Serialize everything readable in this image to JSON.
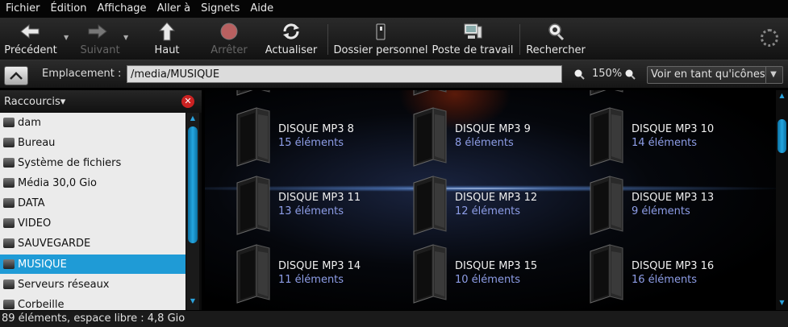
{
  "menu": [
    "Fichier",
    "Édition",
    "Affichage",
    "Aller à",
    "Signets",
    "Aide"
  ],
  "toolbar": {
    "back_label": "Précédent",
    "forward_label": "Suivant",
    "up_label": "Haut",
    "stop_label": "Arrêter",
    "reload_label": "Actualiser",
    "home_label": "Dossier personnel",
    "computer_label": "Poste de travail",
    "search_label": "Rechercher"
  },
  "location": {
    "label": "Emplacement :",
    "value": "/media/MUSIQUE",
    "zoom": "150%",
    "view_mode": "Voir en tant qu'icônes"
  },
  "sidebar": {
    "title": "Raccourcis",
    "items": [
      {
        "label": "dam",
        "icon": "home-icon"
      },
      {
        "label": "Bureau",
        "icon": "desktop-icon"
      },
      {
        "label": "Système de fichiers",
        "icon": "drive-icon"
      },
      {
        "label": "Média 30,0 Gio",
        "icon": "drive-icon"
      },
      {
        "label": "DATA",
        "icon": "drive-icon"
      },
      {
        "label": "VIDEO",
        "icon": "drive-icon"
      },
      {
        "label": "SAUVEGARDE",
        "icon": "drive-icon"
      },
      {
        "label": "MUSIQUE",
        "icon": "drive-icon"
      },
      {
        "label": "Serveurs réseaux",
        "icon": "network-icon"
      },
      {
        "label": "Corbeille",
        "icon": "trash-icon"
      }
    ],
    "selected_index": 7
  },
  "folders": [
    {
      "name": "DISQUE MP3 8",
      "count": "15 éléments"
    },
    {
      "name": "DISQUE MP3 9",
      "count": "8 éléments"
    },
    {
      "name": "DISQUE MP3 10",
      "count": "14 éléments"
    },
    {
      "name": "DISQUE MP3 11",
      "count": "13 éléments"
    },
    {
      "name": "DISQUE MP3 12",
      "count": "12 éléments"
    },
    {
      "name": "DISQUE MP3 13",
      "count": "9 éléments"
    },
    {
      "name": "DISQUE MP3 14",
      "count": "11 éléments"
    },
    {
      "name": "DISQUE MP3 15",
      "count": "10 éléments"
    },
    {
      "name": "DISQUE MP3 16",
      "count": "16 éléments"
    }
  ],
  "status": "89 éléments, espace libre : 4,8 Gio",
  "colors": {
    "selection": "#1f9bd6",
    "item_count": "#8e9ee8"
  }
}
